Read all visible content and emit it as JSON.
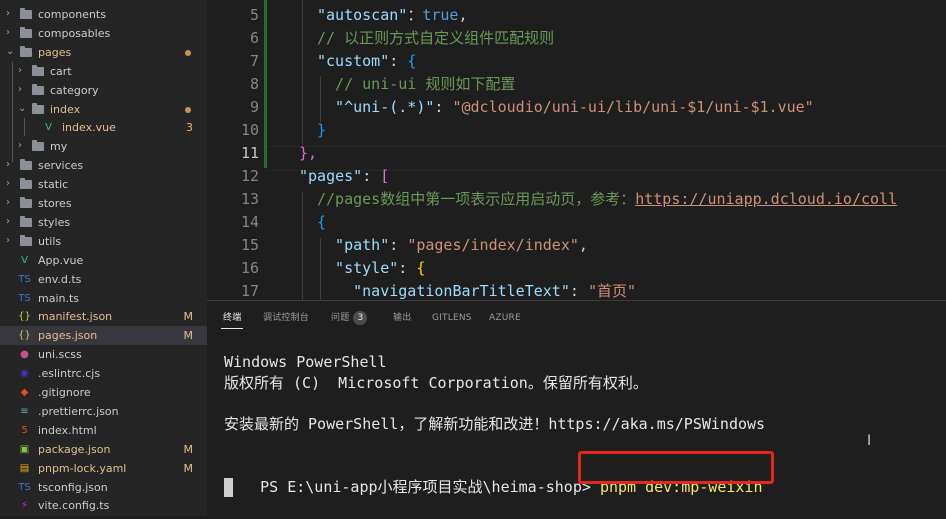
{
  "explorer": {
    "items": [
      {
        "label": "components",
        "kind": "folder",
        "chev": "›"
      },
      {
        "label": "composables",
        "kind": "folder",
        "chev": "›"
      },
      {
        "label": "pages",
        "kind": "folder",
        "chev": "⌄",
        "color": "#e2c08d",
        "dot": true
      },
      {
        "label": "cart",
        "kind": "folder",
        "chev": "›"
      },
      {
        "label": "category",
        "kind": "folder",
        "chev": "›"
      },
      {
        "label": "index",
        "kind": "folder",
        "chev": "⌄",
        "color": "#e2c08d",
        "dot": true
      },
      {
        "label": "index.vue",
        "kind": "vue",
        "color": "#e2c08d",
        "badge": "3"
      },
      {
        "label": "my",
        "kind": "folder",
        "chev": "›"
      },
      {
        "label": "services",
        "kind": "folder",
        "chev": "›"
      },
      {
        "label": "static",
        "kind": "folder",
        "chev": "›"
      },
      {
        "label": "stores",
        "kind": "folder",
        "chev": "›"
      },
      {
        "label": "styles",
        "kind": "folder",
        "chev": "›"
      },
      {
        "label": "utils",
        "kind": "folder",
        "chev": "›"
      },
      {
        "label": "App.vue",
        "kind": "vue"
      },
      {
        "label": "env.d.ts",
        "kind": "ts"
      },
      {
        "label": "main.ts",
        "kind": "ts"
      },
      {
        "label": "manifest.json",
        "kind": "json",
        "color": "#e2c08d",
        "badge": "M"
      },
      {
        "label": "pages.json",
        "kind": "json",
        "color": "#e2c08d",
        "badge": "M",
        "selected": true
      },
      {
        "label": "uni.scss",
        "kind": "scss"
      },
      {
        "label": ".eslintrc.cjs",
        "kind": "eslint"
      },
      {
        "label": ".gitignore",
        "kind": "git"
      },
      {
        "label": ".prettierrc.json",
        "kind": "prettier"
      },
      {
        "label": "index.html",
        "kind": "html"
      },
      {
        "label": "package.json",
        "kind": "pkg",
        "color": "#e2c08d",
        "badge": "M"
      },
      {
        "label": "pnpm-lock.yaml",
        "kind": "yaml",
        "color": "#e2c08d",
        "badge": "M"
      },
      {
        "label": "tsconfig.json",
        "kind": "tsconfig"
      },
      {
        "label": "vite.config.ts",
        "kind": "vite"
      }
    ]
  },
  "editor": {
    "active_line": "11",
    "lines": [
      {
        "n": "5",
        "parts": [
          [
            "k",
            "\"autoscan\""
          ],
          [
            "",
            "："
          ],
          [
            "b",
            "true"
          ],
          [
            "",
            ","
          ]
        ]
      },
      {
        "n": "6",
        "parts": [
          [
            "c",
            "// 以正则方式自定义组件匹配规则"
          ]
        ]
      },
      {
        "n": "7",
        "parts": [
          [
            "k",
            "\"custom\""
          ],
          [
            "",
            ": "
          ],
          [
            "p2",
            "{"
          ]
        ]
      },
      {
        "n": "8",
        "parts": [
          [
            "c",
            "  // uni-ui 规则如下配置"
          ]
        ]
      },
      {
        "n": "9",
        "parts": [
          [
            "k",
            "  \"^uni-(.*)\""
          ],
          [
            "",
            ": "
          ],
          [
            "s",
            "\"@dcloudio/uni-ui/lib/uni-$1/uni-$1.vue\""
          ]
        ]
      },
      {
        "n": "10",
        "parts": [
          [
            "p2",
            "}"
          ]
        ]
      },
      {
        "n": "11",
        "parts": [
          [
            "p1",
            "},"
          ]
        ]
      },
      {
        "n": "12",
        "parts": [
          [
            "k",
            "\"pages\""
          ],
          [
            "",
            ": "
          ],
          [
            "p1",
            "["
          ]
        ]
      },
      {
        "n": "13",
        "parts": [
          [
            "c",
            "//pages数组中第一项表示应用启动页，参考："
          ],
          [
            "url",
            "https://uniapp.dcloud.io/coll"
          ]
        ]
      },
      {
        "n": "14",
        "parts": [
          [
            "p2",
            "{"
          ]
        ]
      },
      {
        "n": "15",
        "parts": [
          [
            "k",
            "  \"path\""
          ],
          [
            "",
            ": "
          ],
          [
            "s",
            "\"pages/index/index\""
          ],
          [
            "",
            ","
          ]
        ]
      },
      {
        "n": "16",
        "parts": [
          [
            "k",
            "  \"style\""
          ],
          [
            "",
            ": "
          ],
          [
            "p3",
            "{"
          ]
        ]
      },
      {
        "n": "17",
        "parts": [
          [
            "k",
            "    \"navigationBarTitleText\""
          ],
          [
            "",
            ": "
          ],
          [
            "s",
            "\"首页\""
          ]
        ]
      }
    ]
  },
  "panel": {
    "tabs": [
      {
        "label": "终端",
        "active": true
      },
      {
        "label": "调试控制台"
      },
      {
        "label": "问题",
        "badge": "3"
      },
      {
        "label": "输出"
      },
      {
        "label": "GITLENS"
      },
      {
        "label": "AZURE"
      }
    ],
    "terminal": {
      "line1": "Windows PowerShell",
      "line2": "版权所有 (C)  Microsoft Corporation。保留所有权利。",
      "line3": "安装最新的 PowerShell，了解新功能和改进！https://aka.ms/PSWindows",
      "prompt": "PS E:\\uni-app小程序项目实战\\heima-shop> ",
      "command": "pnpm dev:mp-weixin",
      "command_color": "#f5e85f"
    }
  }
}
